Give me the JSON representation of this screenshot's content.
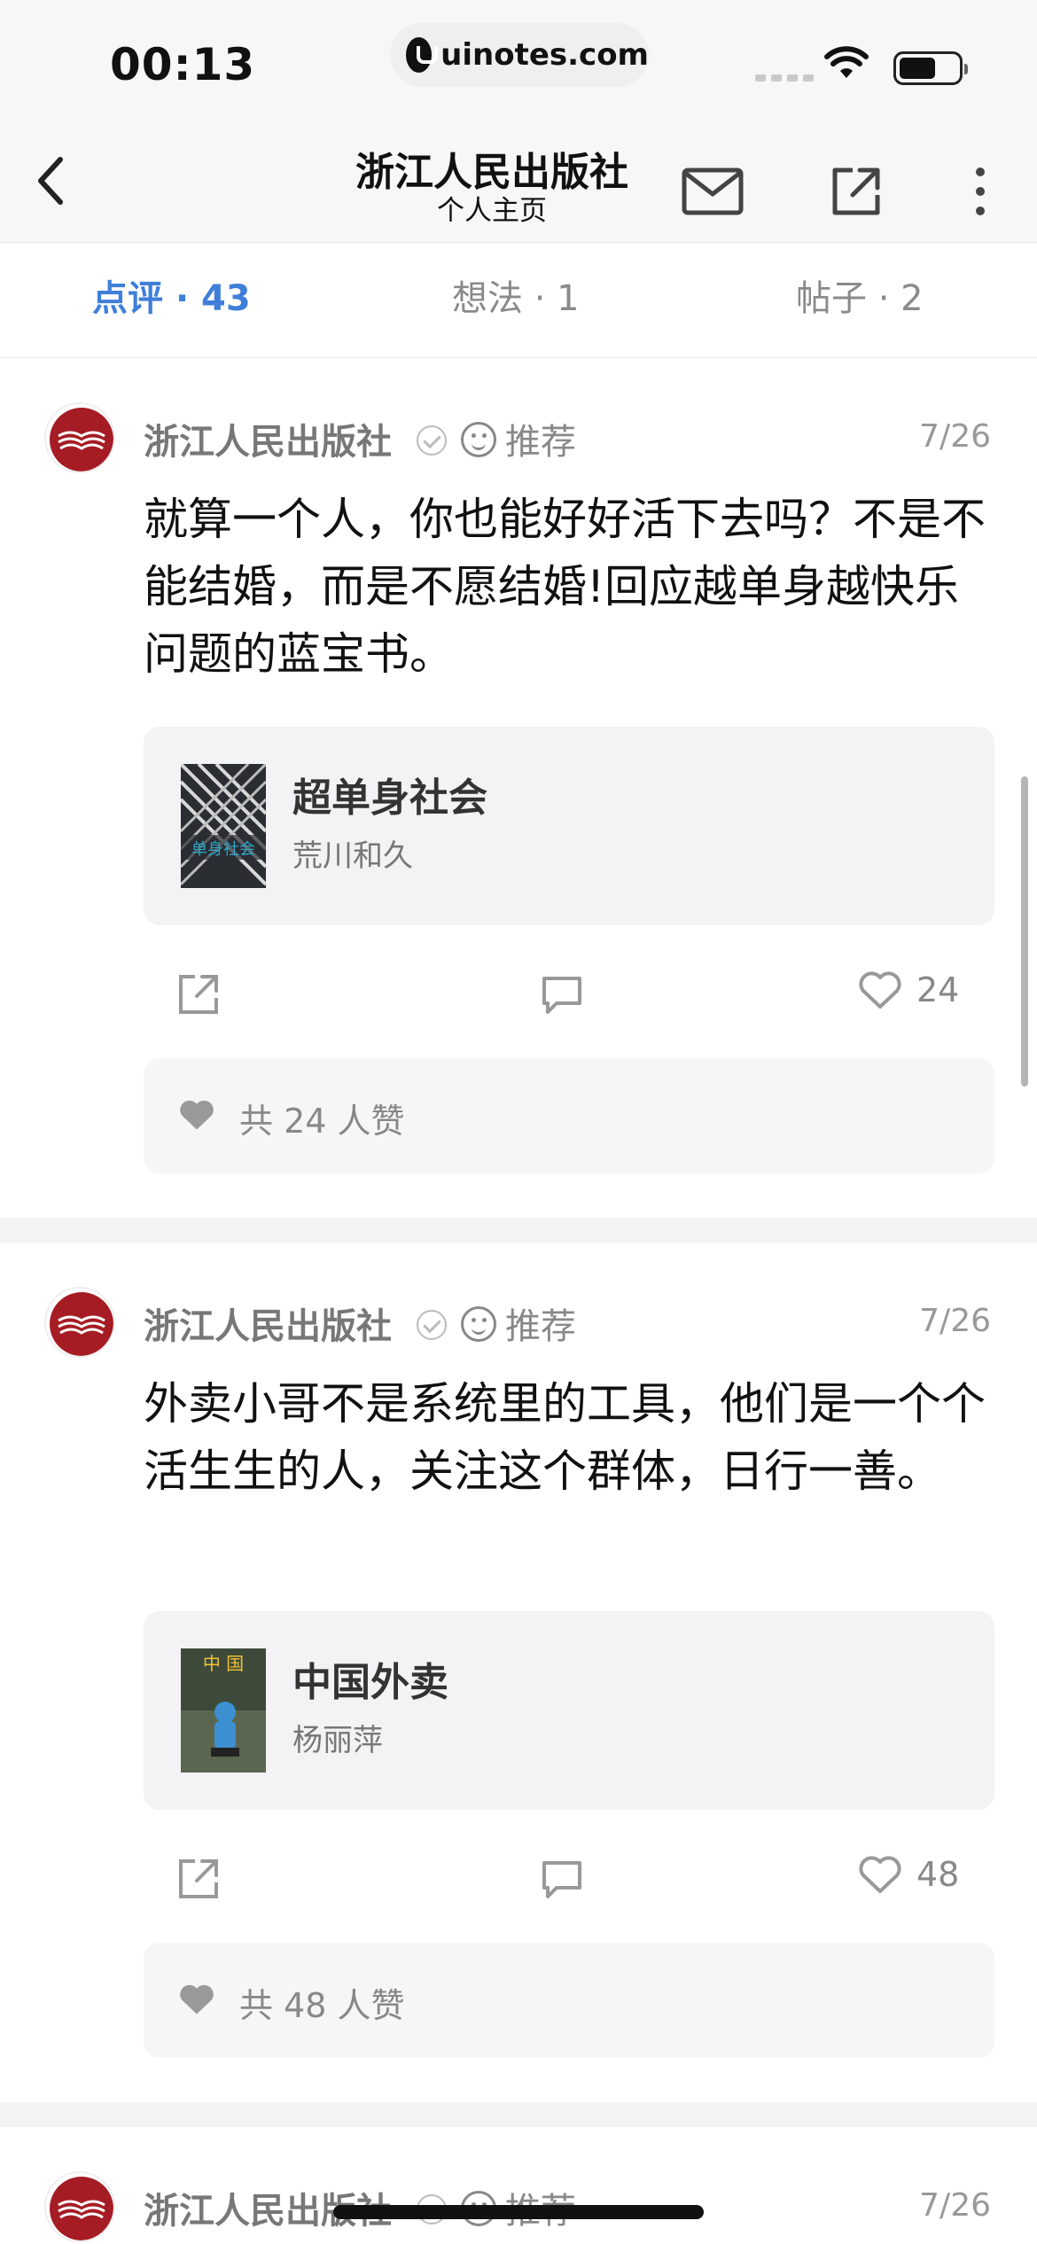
{
  "status_bar": {
    "time": "00:13",
    "url": "uinotes.com"
  },
  "header": {
    "title": "浙江人民出版社",
    "subtitle": "个人主页"
  },
  "tabs": [
    {
      "label": "点评 · 43",
      "active": true
    },
    {
      "label": "想法 · 1",
      "active": false
    },
    {
      "label": "帖子 · 2",
      "active": false
    }
  ],
  "posts": [
    {
      "author": "浙江人民出版社",
      "tag": "推荐",
      "date": "7/26",
      "content": "就算一个人，你也能好好活下去吗？不是不能结婚，而是不愿结婚!回应越单身越快乐问题的蓝宝书。",
      "book": {
        "title": "超单身社会",
        "author": "荒川和久",
        "cover_text": "单身社会"
      },
      "like_count": "24",
      "likes_text": "共 24 人赞"
    },
    {
      "author": "浙江人民出版社",
      "tag": "推荐",
      "date": "7/26",
      "content": "外卖小哥不是系统里的工具，他们是一个个活生生的人，关注这个群体，日行一善。",
      "book": {
        "title": "中国外卖",
        "author": "杨丽萍",
        "cover_text": "中 国"
      },
      "like_count": "48",
      "likes_text": "共 48 人赞"
    },
    {
      "author": "浙江人民出版社",
      "tag": "推荐",
      "date": "7/26"
    }
  ],
  "colors": {
    "accent": "#3f7fd9",
    "brand_red": "#a61c24"
  }
}
